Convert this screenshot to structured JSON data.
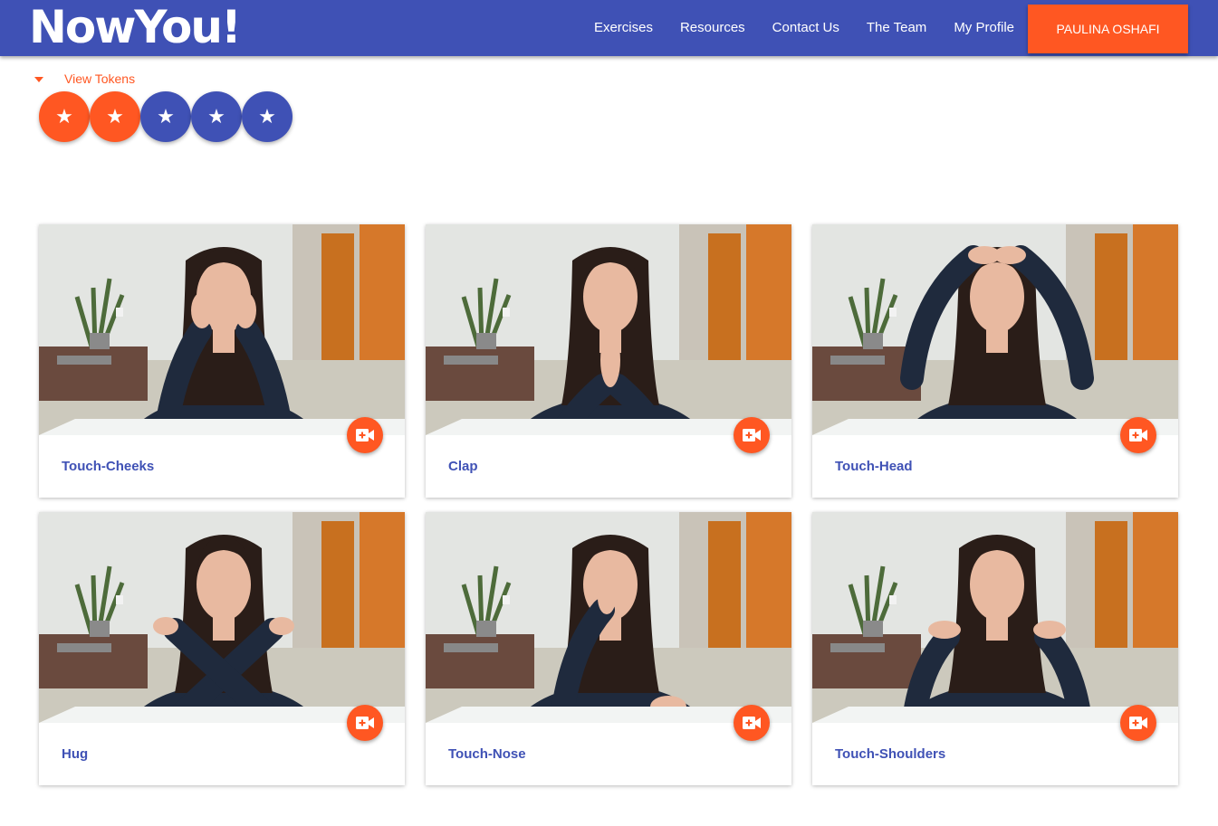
{
  "header": {
    "brand": "NowYou!",
    "nav": [
      {
        "label": "Exercises"
      },
      {
        "label": "Resources"
      },
      {
        "label": "Contact Us"
      },
      {
        "label": "The Team"
      },
      {
        "label": "My Profile"
      }
    ],
    "profile_button": "PAULINA OSHAFI"
  },
  "tokens": {
    "toggle_label": "View Tokens",
    "items": [
      {
        "icon": "star-icon",
        "earned": true
      },
      {
        "icon": "star-icon",
        "earned": true
      },
      {
        "icon": "star-icon",
        "earned": false
      },
      {
        "icon": "star-icon",
        "earned": false
      },
      {
        "icon": "star-icon",
        "earned": false
      }
    ]
  },
  "exercises": [
    {
      "title": "Touch-Cheeks",
      "pose": "cheeks"
    },
    {
      "title": "Clap",
      "pose": "clap"
    },
    {
      "title": "Touch-Head",
      "pose": "head"
    },
    {
      "title": "Hug",
      "pose": "hug"
    },
    {
      "title": "Touch-Nose",
      "pose": "nose"
    },
    {
      "title": "Touch-Shoulders",
      "pose": "shoulders"
    }
  ],
  "colors": {
    "primary": "#3f51b5",
    "accent": "#ff5722",
    "token_earned": "#ff5722",
    "token_unearned": "#3f51b5"
  },
  "icons": {
    "fab": "video-add-icon"
  }
}
